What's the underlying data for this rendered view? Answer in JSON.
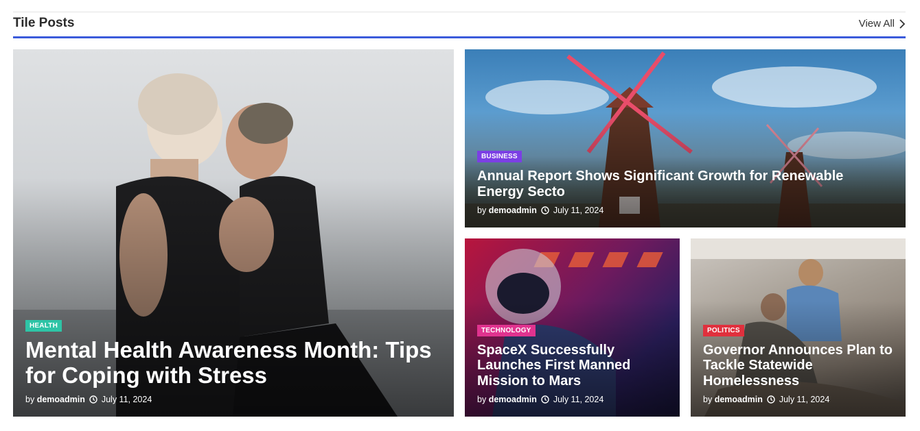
{
  "section": {
    "title": "Tile Posts",
    "view_all": "View All"
  },
  "posts": [
    {
      "category": "HEALTH",
      "title": "Mental Health Awareness Month: Tips for Coping with Stress",
      "author_prefix": "by",
      "author": "demoadmin",
      "date": "July 11, 2024",
      "badge_color": "#2ec4a6"
    },
    {
      "category": "BUSINESS",
      "title": "Annual Report Shows Significant Growth for Renewable Energy Secto",
      "author_prefix": "by",
      "author": "demoadmin",
      "date": "July 11, 2024",
      "badge_color": "#7b3fe4"
    },
    {
      "category": "TECHNOLOGY",
      "title": "SpaceX Successfully Launches First Manned Mission to Mars",
      "author_prefix": "by",
      "author": "demoadmin",
      "date": "July 11, 2024",
      "badge_color": "#e0338f"
    },
    {
      "category": "POLITICS",
      "title": "Governor Announces Plan to Tackle Statewide Homelessness",
      "author_prefix": "by",
      "author": "demoadmin",
      "date": "July 11, 2024",
      "badge_color": "#e0303d"
    }
  ],
  "theme": {
    "accent": "#3b5bdb"
  },
  "icons": {
    "view_all": "chevron-right-icon",
    "date": "clock-icon"
  }
}
